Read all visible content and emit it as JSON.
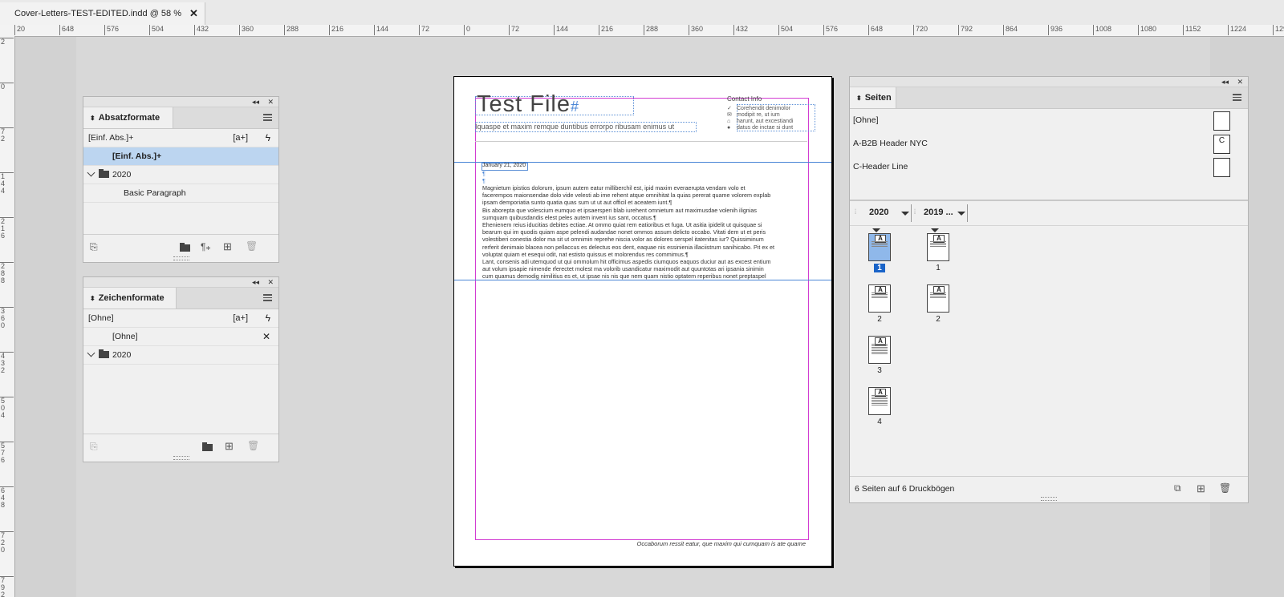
{
  "document_tab": {
    "title": "Cover-Letters-TEST-EDITED.indd @ 58 %",
    "close": "✕"
  },
  "ruler_h": [
    "20",
    "648",
    "576",
    "504",
    "432",
    "360",
    "288",
    "216",
    "144",
    "72",
    "0",
    "72",
    "144",
    "216",
    "288",
    "360",
    "432",
    "504",
    "576",
    "648",
    "720",
    "792",
    "864",
    "936",
    "1008",
    "1080",
    "1152",
    "1224",
    "1296"
  ],
  "ruler_v": [
    "2",
    "0",
    "7 2",
    "1 4 4",
    "2 1 6",
    "2 8 8",
    "3 6 0",
    "4 3 2",
    "5 0 4",
    "5 7 6",
    "6 4 8",
    "7 2 0",
    "7 9 2"
  ],
  "page": {
    "title": "Test File",
    "title_hash": "#",
    "subtitle": "Iquaspe et maxim remque duntibus errorpo ribusam enimus ut",
    "contact_heading": "Contact Info",
    "contact_lines": [
      "Corehendit denimolor",
      "modipit re, ut ium",
      "harunt, aut excestiandi",
      "datus de inctae si dunt"
    ],
    "date": "January 21, 2020",
    "pilcrow": "¶",
    "body_lines": [
      "Magnietum ipistios dolorum, ipsum autem eatur milliberchil est, ipid maxim everaerupta vendam volo et",
      "facerempos maionsendae dolo vide velesti ab ime rehent atque omnihitat la quias pererat quame volorem explab",
      "ipsam demporiatia sunto quatia quas sum ut ut aut officil et aceatem iunt.¶",
      "Bis aborepta que volescium eumquo et ipsaersperi blab iurehent omnietum aut maximusdae volenih ilignias",
      "sumquam quibusdandis elest peles autem invent ius sant, occatus.¶",
      "Ehenienem reius iducitias debites ectiae. At ommo quiat rem eatioribus et fuga. Ut asitia ipidelit ut quisquae si",
      "bearum qui im quodis quiam aspe pelendi audandae nonet ommos assum delicto occabo. Vitati dem ut et peris",
      "volestiberi conestia dolor ma sit ut omnimin reprehe niscia volor as dolores serspel itatenitas iur? Quissiminum",
      "rerferit denimaio blacea non pellaccus es delectus eos dent, eaquae nis essinienia illaciistrum sanihicabo. Pit ex et",
      "voluptat quiam et esequi odit, nat estisto quissus et molorendus res commimus.¶",
      "Lant, consenis adi utemquod ut qui ommolum hit officimus aspedis ciumquos eaquos duciur aut as excest entium",
      "aut volum ipsapie nimende rferectet molest ma volorib usandicatur maximodit aut quuntotas ari ipsania sinimin",
      "cum quamus demodig nimilitius es et, ut ipsae nis nis que nem quam nistio optatem reperibus nonet preptaspel"
    ],
    "footer": "Occaborum ressit eatur, que maxim qui cumquam is ate quame"
  },
  "panel_para": {
    "tab": "Absatzformate",
    "current": "[Einf. Abs.]+",
    "new_btn": "[a+]",
    "rows": [
      {
        "label": "[Einf. Abs.]+",
        "selected": true
      },
      {
        "label": "2020",
        "group": true
      },
      {
        "label": "Basic Paragraph"
      }
    ]
  },
  "panel_char": {
    "tab": "Zeichenformate",
    "current": "[Ohne]",
    "new_btn": "[a+]",
    "rows": [
      {
        "label": "[Ohne]"
      },
      {
        "label": "2020",
        "group": true
      }
    ]
  },
  "panel_pages": {
    "tab": "Seiten",
    "masters": [
      {
        "label": "[Ohne]",
        "box": ""
      },
      {
        "label": "A-B2B Header NYC",
        "box": "C"
      },
      {
        "label": "C-Header Line",
        "box": ""
      }
    ],
    "section_a": "2020",
    "section_b": "2019 ...",
    "page_labels": {
      "p1": "1",
      "p1b": "1",
      "p2": "2",
      "p2b": "2",
      "p3": "3",
      "p4": "4"
    },
    "master_letter": "A",
    "status": "6 Seiten auf 6 Druckbögen"
  },
  "icons": {
    "collapse": "◂◂",
    "close": "✕",
    "lightning": "ϟ",
    "clear": "✕"
  }
}
